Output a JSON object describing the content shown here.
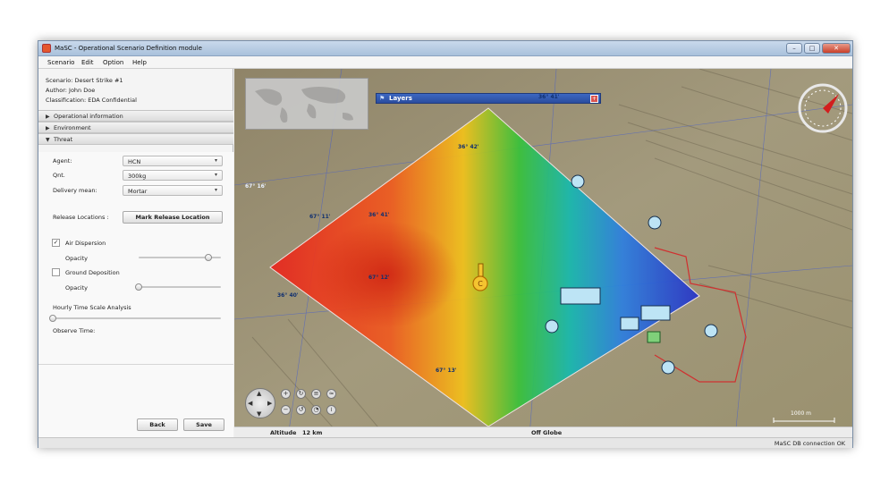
{
  "window": {
    "title": "MaSC - Operational Scenario Definition module",
    "buttons": {
      "minimize": "–",
      "maximize": "□",
      "close": "✕"
    }
  },
  "menu": [
    "Scenario",
    "Edit",
    "Option",
    "Help"
  ],
  "scenario_info": {
    "scenario": "Scenario: Desert Strike #1",
    "author": "Author: John Doe",
    "classification": "Classification: EDA Confidential"
  },
  "sections": {
    "operational": "Operational information",
    "environment": "Environment",
    "threat": "Threat"
  },
  "threat": {
    "agent_label": "Agent:",
    "agent_value": "HCN",
    "qnt_label": "Qnt.",
    "qnt_value": "300kg",
    "delivery_label": "Delivery mean:",
    "delivery_value": "Mortar",
    "release_label": "Release Locations :",
    "release_button": "Mark Release Location",
    "air_dispersion": {
      "label": "Air Dispersion",
      "checked": true,
      "opacity_label": "Opacity",
      "opacity": 0.85
    },
    "ground_deposition": {
      "label": "Ground Deposition",
      "checked": false,
      "opacity_label": "Opacity",
      "opacity": 0.0
    },
    "hourly_label": "Hourly Time Scale Analysis",
    "hourly_value": 0.0,
    "observe_label": "Observe Time:"
  },
  "actions": {
    "back": "Back",
    "save": "Save"
  },
  "map": {
    "layers_title": "Layers",
    "layers_icon": "⚑",
    "close_icon": "+",
    "coord_labels": [
      "36° 41'",
      "36° 42'",
      "67° 16'",
      "67° 11'",
      "36° 41'",
      "67° 12'",
      "36° 40'",
      "67° 13'"
    ],
    "marker_label": "C",
    "scale_label": "1000 m",
    "bottom_altitude": "Altitude",
    "bottom_altitude_value": "12 km",
    "bottom_globe": "Off Globe",
    "nav_icons": [
      "+",
      "↻",
      "≡",
      "≈",
      "−",
      "↺",
      "◔",
      "≀"
    ]
  },
  "status": "MaSC DB connection OK",
  "colors": {
    "accent": "#2a4d9f",
    "close": "#c9402a"
  }
}
